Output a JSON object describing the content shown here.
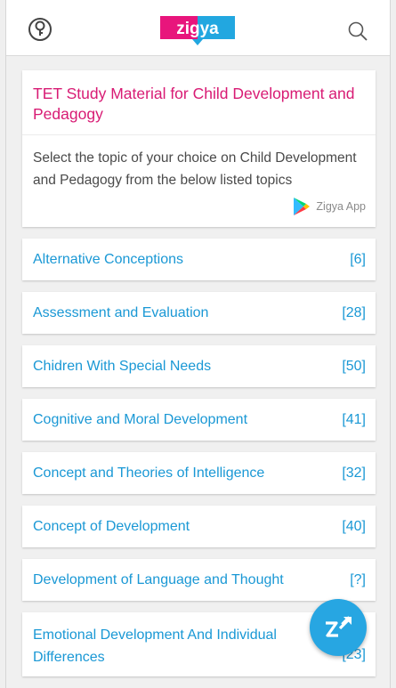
{
  "header": {
    "logo_text": "zigya",
    "left_icon": "tips-icon",
    "right_icon": "search-icon"
  },
  "intro": {
    "title": "TET Study Material for Child Development and Pedagogy",
    "description": "Select the topic of your choice on Child Development and Pedagogy from the below listed topics",
    "app_label": "Zigya App"
  },
  "topics": [
    {
      "name": "Alternative Conceptions",
      "count": "[6]"
    },
    {
      "name": "Assessment and Evaluation",
      "count": "[28]"
    },
    {
      "name": "Chidren With Special Needs",
      "count": "[50]"
    },
    {
      "name": "Cognitive and Moral Development",
      "count": "[41]"
    },
    {
      "name": "Concept and Theories of Intelligence",
      "count": "[32]"
    },
    {
      "name": "Concept of Development",
      "count": "[40]"
    },
    {
      "name": "Development of Language and Thought",
      "count": "[?]"
    },
    {
      "name": "Emotional Development And Individual Differences",
      "count": "[23]"
    }
  ],
  "colors": {
    "brand_pink": "#d81b74",
    "link_blue": "#1a98d5",
    "fab_blue": "#27a6e2"
  }
}
